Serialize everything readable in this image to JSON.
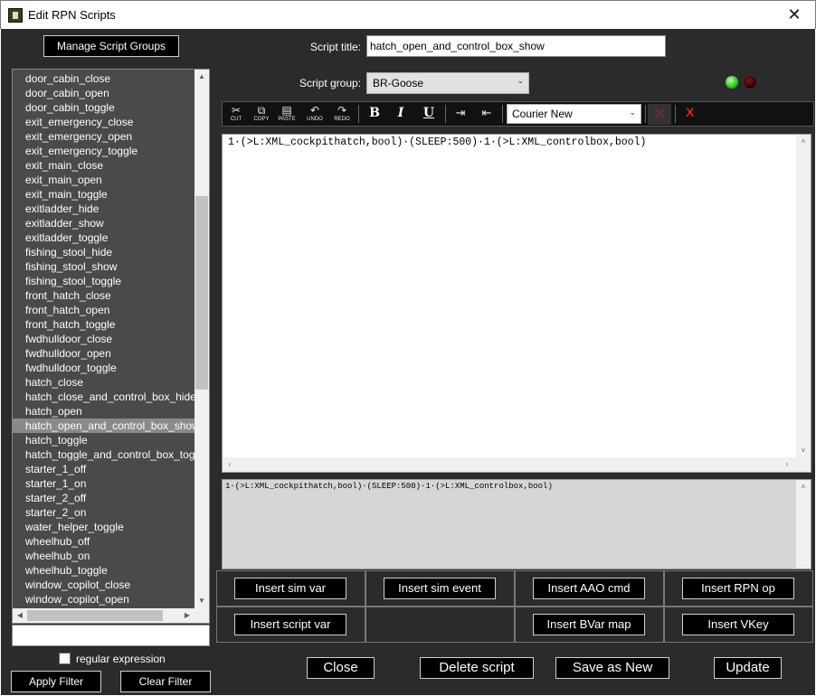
{
  "window": {
    "title": "Edit RPN Scripts",
    "close_glyph": "✕"
  },
  "left": {
    "manage_label": "Manage Script Groups",
    "scripts": [
      "door_cabin_close",
      "door_cabin_open",
      "door_cabin_toggle",
      "exit_emergency_close",
      "exit_emergency_open",
      "exit_emergency_toggle",
      "exit_main_close",
      "exit_main_open",
      "exit_main_toggle",
      "exitladder_hide",
      "exitladder_show",
      "exitladder_toggle",
      "fishing_stool_hide",
      "fishing_stool_show",
      "fishing_stool_toggle",
      "front_hatch_close",
      "front_hatch_open",
      "front_hatch_toggle",
      "fwdhulldoor_close",
      "fwdhulldoor_open",
      "fwdhulldoor_toggle",
      "hatch_close",
      "hatch_close_and_control_box_hide",
      "hatch_open",
      "hatch_open_and_control_box_show",
      "hatch_toggle",
      "hatch_toggle_and_control_box_toggle",
      "starter_1_off",
      "starter_1_on",
      "starter_2_off",
      "starter_2_on",
      "water_helper_toggle",
      "wheelhub_off",
      "wheelhub_on",
      "wheelhub_toggle",
      "window_copilot_close",
      "window_copilot_open"
    ],
    "selected_script": "hatch_open_and_control_box_show",
    "filter_value": "",
    "regex_label": "regular expression",
    "regex_checked": false,
    "apply_label": "Apply Filter",
    "clear_label": "Clear Filter"
  },
  "form": {
    "title_label": "Script title:",
    "title_value": "hatch_open_and_control_box_show",
    "group_label": "Script group:",
    "group_value": "BR-Goose",
    "status_colors": {
      "green": "#2ecc20",
      "red": "#3a0000"
    }
  },
  "toolbar": {
    "cut": "CUT",
    "copy": "COPY",
    "paste": "PASTE",
    "undo": "UNDO",
    "redo": "REDO",
    "bold": "B",
    "italic": "I",
    "underline": "U",
    "font": "Courier New",
    "clear": "X"
  },
  "editor": {
    "code": "1·(>L:XML_cockpithatch,bool)·(SLEEP:500)·1·(>L:XML_controlbox,bool)",
    "preview": "1·(>L:XML_cockpithatch,bool)·(SLEEP:500)·1·(>L:XML_controlbox,bool)"
  },
  "insert": {
    "sim_var": "Insert sim var",
    "sim_event": "Insert sim event",
    "aao_cmd": "Insert AAO cmd",
    "rpn_op": "Insert RPN op",
    "script_var": "Insert script var",
    "bvar_map": "Insert BVar map",
    "vkey": "Insert VKey"
  },
  "actions": {
    "close": "Close",
    "delete": "Delete script",
    "save_new": "Save as New",
    "update": "Update"
  }
}
